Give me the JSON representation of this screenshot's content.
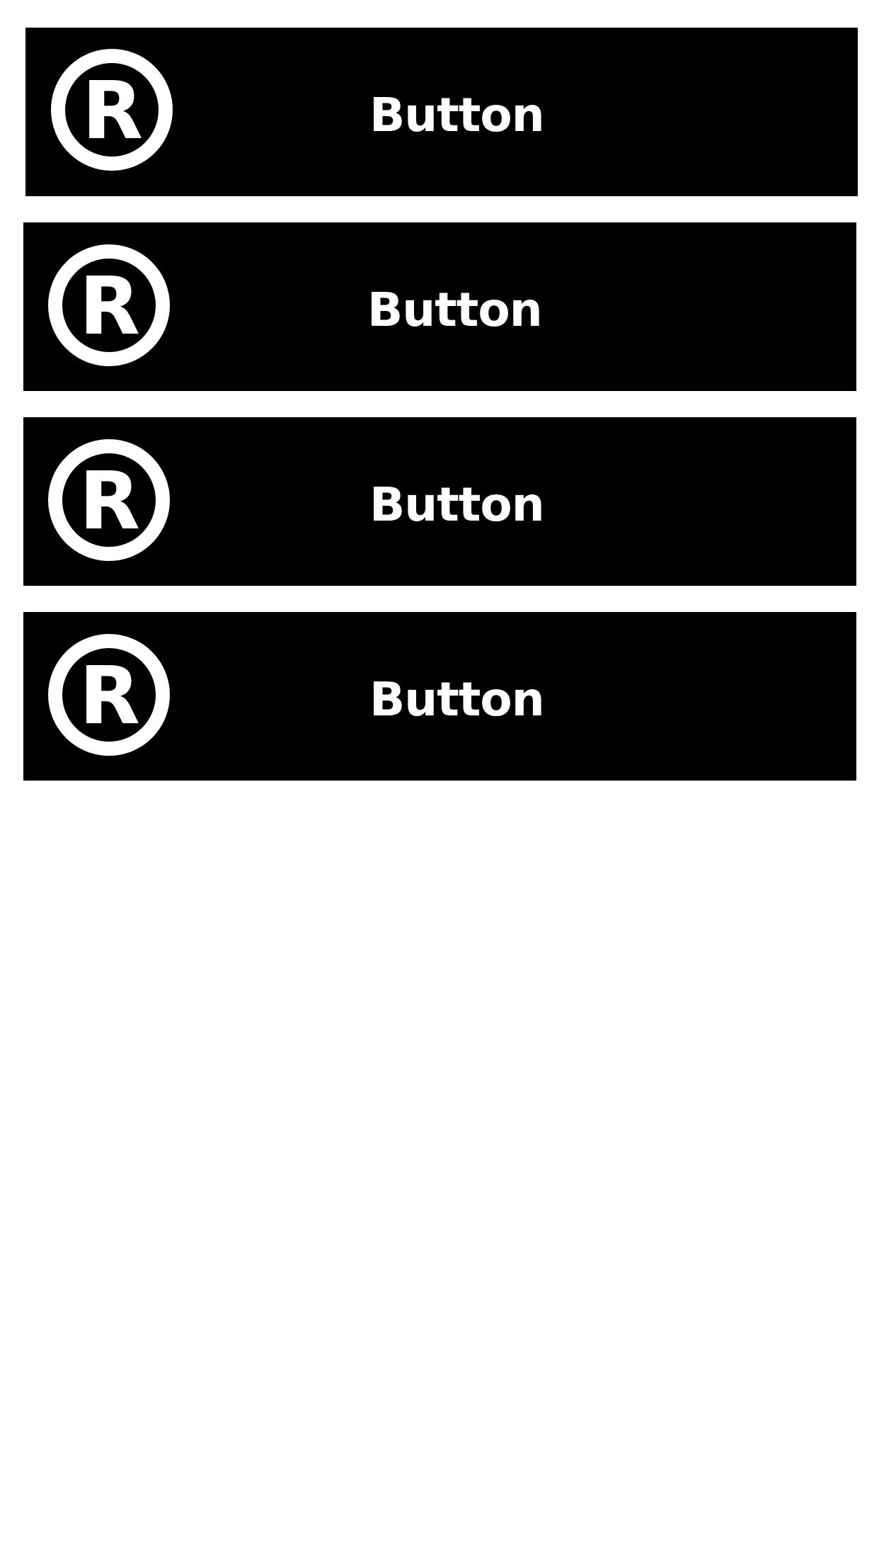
{
  "buttons": [
    {
      "label": "Button",
      "icon": "registered-trademark-icon"
    },
    {
      "label": "Button",
      "icon": "registered-trademark-icon"
    },
    {
      "label": "Button",
      "icon": "registered-trademark-icon"
    },
    {
      "label": "Button",
      "icon": "registered-trademark-icon"
    }
  ],
  "colors": {
    "background": "#ffffff",
    "button_background": "#000000",
    "button_foreground": "#ffffff"
  }
}
